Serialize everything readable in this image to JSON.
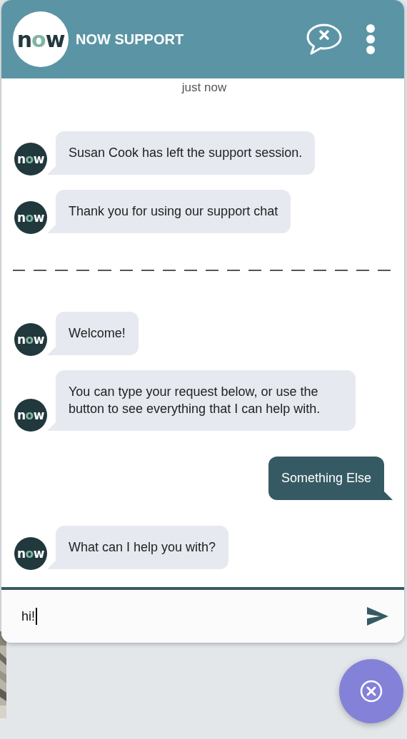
{
  "header": {
    "logo": "now",
    "title": "NOW SUPPORT"
  },
  "messages": [
    {
      "kind": "time",
      "text": "just now"
    },
    {
      "kind": "bot",
      "avatar": "now",
      "text": "Susan Cook has left the support session."
    },
    {
      "kind": "bot",
      "avatar": "now",
      "text": "Thank you for using our support chat"
    },
    {
      "kind": "divider"
    },
    {
      "kind": "bot",
      "avatar": "now",
      "text": "Welcome!"
    },
    {
      "kind": "bot",
      "avatar": "now",
      "text": "You can type your request below, or use the button to see everything that I can help with."
    },
    {
      "kind": "user",
      "text": "Something Else"
    },
    {
      "kind": "bot",
      "avatar": "now",
      "text": "What can I help you with?"
    }
  ],
  "input": {
    "value": "hi!"
  }
}
